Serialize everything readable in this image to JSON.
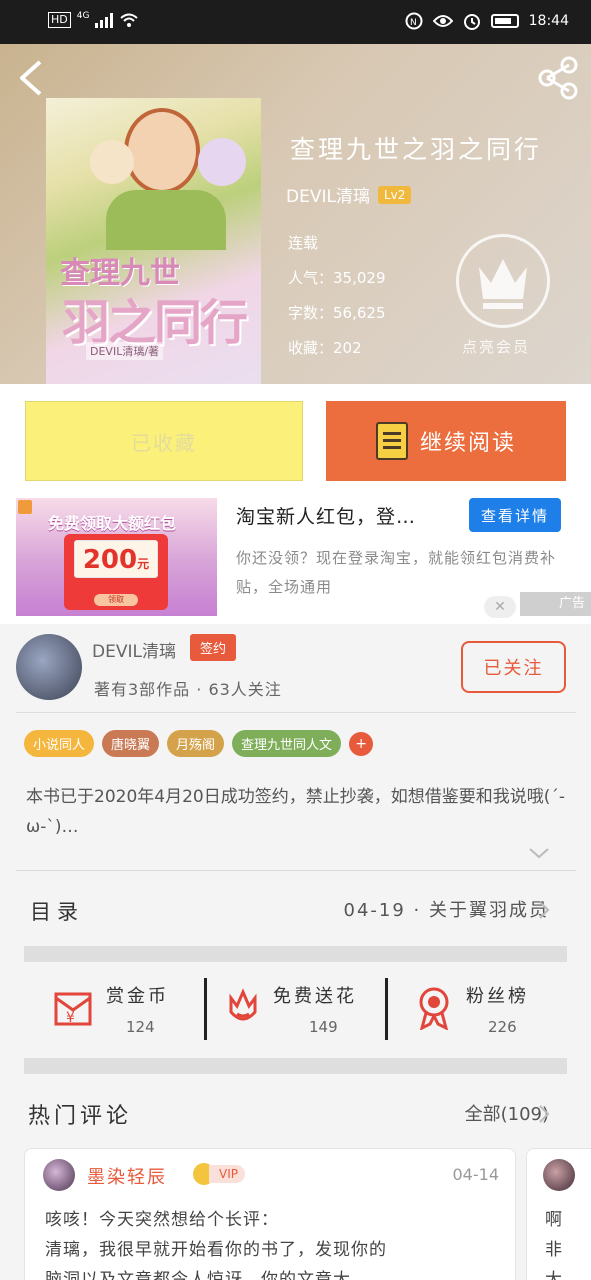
{
  "status_bar": {
    "network": "4G",
    "time": "18:44",
    "hd": "HD"
  },
  "book": {
    "title": "查理九世之羽之同行",
    "author": "DEVIL清璃",
    "level": "Lv2",
    "status": "连载",
    "popularity": "人气：35,029",
    "word_count": "字数：56,625",
    "favorites": "收藏：202",
    "member_label": "点亮会员",
    "cover_title_line1": "查理九世",
    "cover_title_line2": "羽之同行",
    "cover_subtitle": "DEVIL清璃/著"
  },
  "actions": {
    "fav_label": "已收藏",
    "read_label": "继续阅读"
  },
  "ad": {
    "image_headline": "免费领取大额红包",
    "image_amount": "200",
    "image_unit": "元",
    "image_button": "领取",
    "title": "淘宝新人红包，登…",
    "detail_button": "查看详情",
    "description": "你还没领？现在登录淘宝，就能领红包消费补贴，全场通用",
    "tag": "广告"
  },
  "author_section": {
    "name": "DEVIL清璃",
    "sign_badge": "签约",
    "subtitle": "著有3部作品 · 63人关注",
    "follow_label": "已关注"
  },
  "tags": [
    {
      "label": "小说同人",
      "color": "#f4b63c"
    },
    {
      "label": "唐晓翼",
      "color": "#c97a55"
    },
    {
      "label": "月殇阁",
      "color": "#d4a24a"
    },
    {
      "label": "查理九世同人文",
      "color": "#7fae5a"
    }
  ],
  "tag_add": "+",
  "intro": "本书已于2020年4月20日成功签约，禁止抄袭，如想借鉴要和我说哦(´-ω-`)…",
  "toc": {
    "label": "目录",
    "latest": "04-19 · 关于翼羽成员"
  },
  "rewards": [
    {
      "title": "赏金币",
      "count": "124"
    },
    {
      "title": "免费送花",
      "count": "149"
    },
    {
      "title": "粉丝榜",
      "count": "226"
    }
  ],
  "comments_section": {
    "label": "热门评论",
    "all_label": "全部(109)"
  },
  "comments": [
    {
      "user": "墨染轻辰",
      "vip": "VIP",
      "date": "04-14",
      "text_line1": "咳咳！今天突然想给个长评：",
      "text_line2": "清璃，我很早就开始看你的书了，发现你的",
      "text_line3": "脑洞以及文章都令人惊讶，你的文章大…"
    },
    {
      "text_line1": "啊",
      "text_line2": "非",
      "text_line3": "大"
    }
  ],
  "colors": {
    "accent": "#e75a3c",
    "read_button": "#ec6d3d",
    "fav_button": "#fbf17a",
    "ad_button": "#1e7fe8"
  }
}
